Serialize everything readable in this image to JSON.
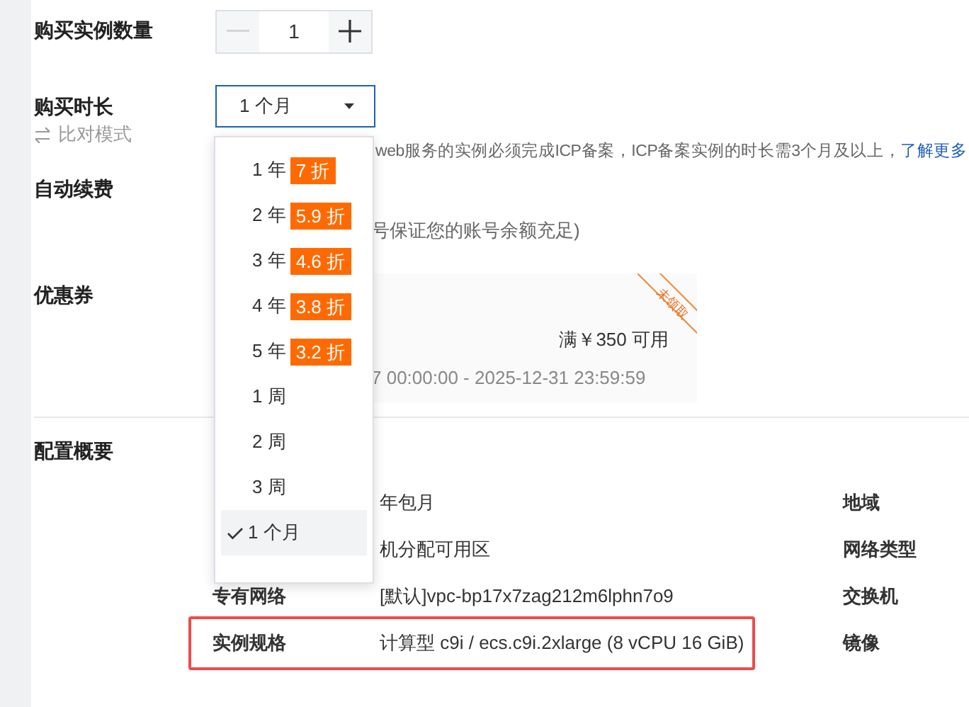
{
  "quantity": {
    "label": "购买实例数量",
    "value": "1",
    "minus_disabled": true
  },
  "duration": {
    "label": "购买时长",
    "value": "1 个月",
    "compare": "比对模式"
  },
  "icp_note": {
    "text": "web服务的实例必须完成ICP备案，ICP备案实例的时长需3个月及以上，",
    "link": "了解更多"
  },
  "auto_renew": {
    "label": "自动续费",
    "note": "号保证您的账号余额充足)"
  },
  "coupon": {
    "label": "优惠券",
    "condition": "满￥350 可用",
    "validity": "7 00:00:00 - 2025-12-31 23:59:59",
    "stamp": "未领取"
  },
  "summary": {
    "label": "配置概要",
    "rows": [
      {
        "value": "年包月",
        "side_label": "地域",
        "highlighted": false
      },
      {
        "value": "机分配可用区",
        "side_label": "网络类型",
        "highlighted": false
      },
      {
        "label": "专有网络",
        "value": "[默认]vpc-bp17x7zag212m6lphn7o9",
        "side_label": "交换机",
        "highlighted": false
      },
      {
        "label": "实例规格",
        "value": "计算型 c9i / ecs.c9i.2xlarge (8 vCPU 16 GiB)",
        "side_label": "镜像",
        "highlighted": true
      }
    ]
  },
  "dropdown": {
    "options": [
      {
        "label": "1 年",
        "discount": "7 折",
        "selected": false
      },
      {
        "label": "2 年",
        "discount": "5.9 折",
        "selected": false
      },
      {
        "label": "3 年",
        "discount": "4.6 折",
        "selected": false
      },
      {
        "label": "4 年",
        "discount": "3.8 折",
        "selected": false
      },
      {
        "label": "5 年",
        "discount": "3.2 折",
        "selected": false
      },
      {
        "label": "1 周",
        "selected": false
      },
      {
        "label": "2 周",
        "selected": false
      },
      {
        "label": "3 周",
        "selected": false
      },
      {
        "label": "1 个月",
        "selected": true
      }
    ]
  }
}
